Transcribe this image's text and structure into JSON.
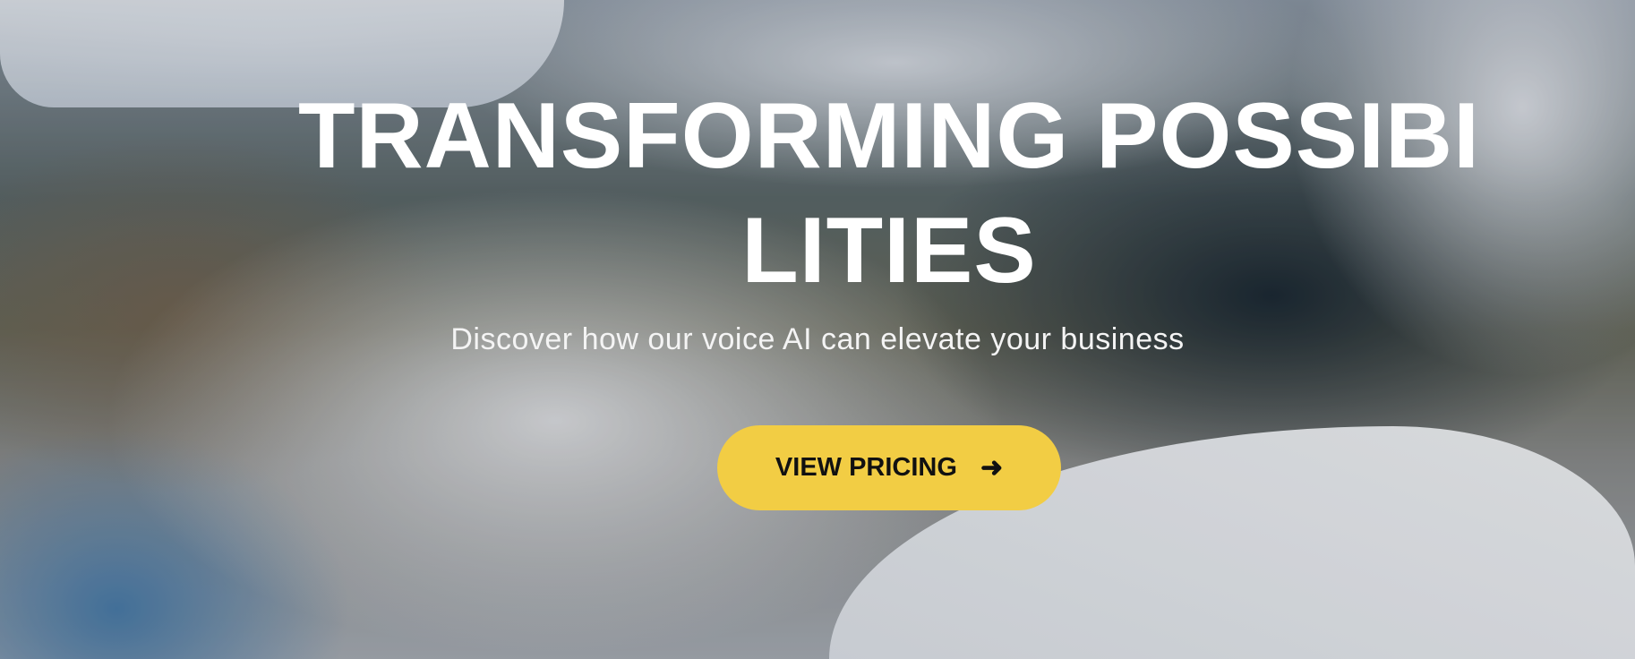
{
  "hero": {
    "title": "TRANSFORMING POSSIBILITIES",
    "subtitle": "Discover how our voice AI can elevate your business",
    "cta_label": "VIEW PRICING",
    "cta_icon": "arrow-right-icon",
    "cta_color": "#f2cd44"
  }
}
